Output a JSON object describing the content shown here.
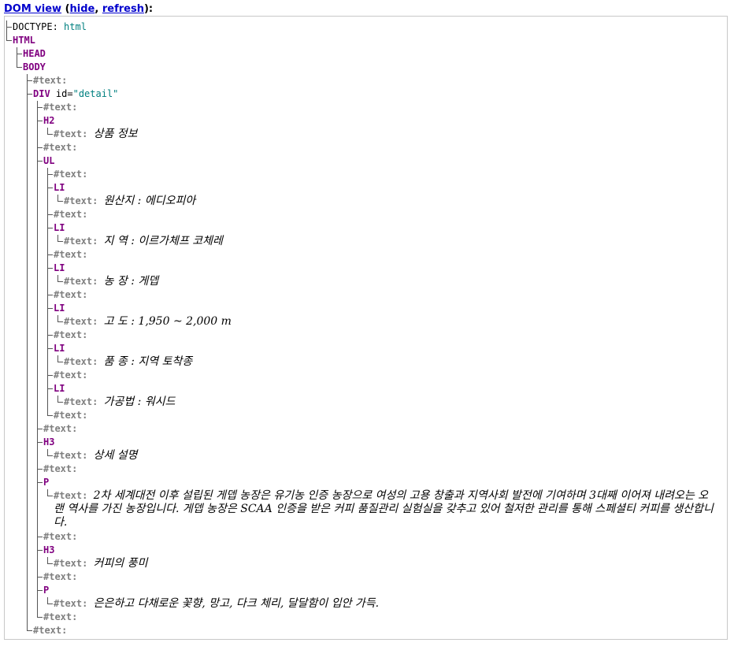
{
  "header": {
    "title": "DOM view",
    "hide_label": "hide",
    "refresh_label": "refresh",
    "paren_open": " (",
    "separator": ", ",
    "paren_close": "):"
  },
  "tree": {
    "doctype_label": "DOCTYPE:",
    "doctype_value": "html",
    "nodes": {
      "html": "HTML",
      "head": "HEAD",
      "body": "BODY",
      "div": "DIV",
      "div_attr": "id=",
      "div_attr_value": "\"detail\"",
      "h2": "H2",
      "ul": "UL",
      "li": "LI",
      "h3": "H3",
      "p": "P"
    },
    "text_node_label": "#text:",
    "texts": {
      "h2": "상품 정보",
      "li1": "원산지 : 에디오피아",
      "li2": "지 역 : 이르가체프 코체레",
      "li3": "농 장 : 게뎁",
      "li4": "고 도 : 1,950 ~ 2,000 m",
      "li5": "품 종 : 지역 토착종",
      "li6": "가공법 : 워시드",
      "h3a": "상세 설명",
      "p1": "2차 세계대전 이후 설립된 게뎁 농장은 유기농 인증 농장으로 여성의 고용 창출과 지역사회 발전에 기여하며 3대째 이어져 내려오는 오랜 역사를 가진 농장입니다. 게뎁 농장은 SCAA 인증을 받은 커피 품질관리 실험실을 갖추고 있어 철저한 관리를 통해 스페셜티 커피를 생산합니다.",
      "h3b": "커피의 풍미",
      "p2": "은은하고 다채로운 꽃향, 망고, 다크 체리, 달달함이 입안 가득."
    }
  }
}
